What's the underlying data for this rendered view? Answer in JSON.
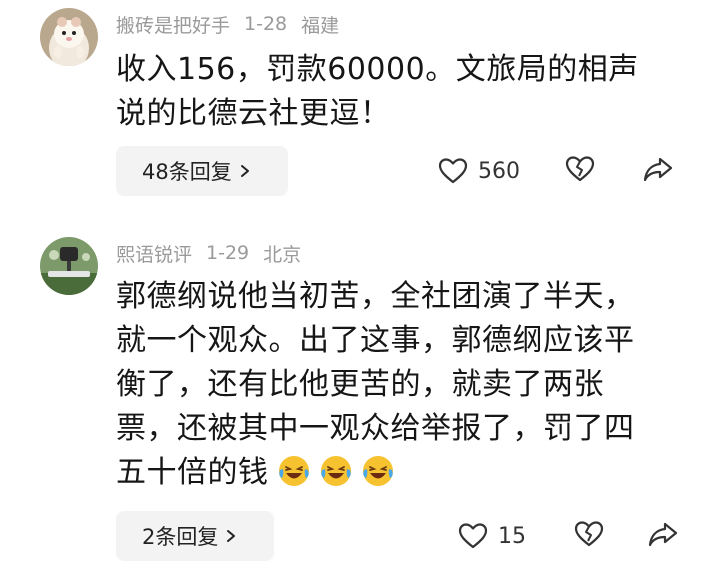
{
  "comments": [
    {
      "username": "搬砖是把好手",
      "date": "1-28",
      "location": "福建",
      "lines": [
        "收入156，罚款60000。文旅局的相声",
        "说的比德云社更逗！"
      ],
      "reply_label": "48条回复",
      "like_count": "560",
      "avatar_icon": "hamster-avatar",
      "icons": [
        "heart-outline-icon",
        "broken-heart-icon",
        "share-arrow-icon"
      ]
    },
    {
      "username": "熙语锐评",
      "date": "1-29",
      "location": "北京",
      "lines": [
        "郭德纲说他当初苦，全社团演了半天，",
        "就一个观众。出了这事，郭德纲应该平",
        "衡了，还有比他更苦的，就卖了两张",
        "票，还被其中一观众给举报了，罚了四",
        "五十倍的钱"
      ],
      "emoji": [
        "😂",
        "😂",
        "😂"
      ],
      "reply_label": "2条回复",
      "like_count": "15",
      "avatar_icon": "microphone-avatar",
      "icons": [
        "heart-outline-icon",
        "broken-heart-icon",
        "share-arrow-icon"
      ]
    }
  ],
  "colors": {
    "meta_text": "#9a9a9a",
    "body_text": "#161616",
    "reply_bg": "#f3f3f3",
    "icon_stroke": "#333333",
    "emoji_face": "#f7c22f"
  }
}
